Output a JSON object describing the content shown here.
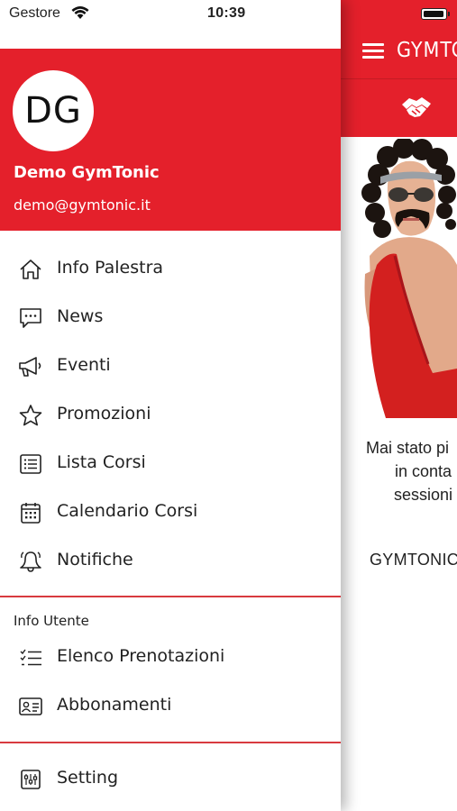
{
  "status_bar": {
    "carrier": "Gestore",
    "time": "10:39"
  },
  "user": {
    "initials": "DG",
    "name": "Demo GymTonic",
    "email": "demo@gymtonic.it"
  },
  "menu": [
    {
      "label": "Info Palestra",
      "icon": "home-icon"
    },
    {
      "label": "News",
      "icon": "chat-bubble-icon"
    },
    {
      "label": "Eventi",
      "icon": "megaphone-icon"
    },
    {
      "label": "Promozioni",
      "icon": "star-icon"
    },
    {
      "label": "Lista Corsi",
      "icon": "list-icon"
    },
    {
      "label": "Calendario Corsi",
      "icon": "calendar-icon"
    },
    {
      "label": "Notifiche",
      "icon": "bell-icon"
    }
  ],
  "user_section": {
    "title": "Info Utente",
    "items": [
      {
        "label": "Elenco Prenotazioni",
        "icon": "checklist-icon"
      },
      {
        "label": "Abbonamenti",
        "icon": "id-card-icon"
      }
    ]
  },
  "settings": {
    "label": "Setting",
    "icon": "settings-sliders-icon"
  },
  "main_screen": {
    "title": "GYMTC",
    "tab_icon": "handshake-icon",
    "promo_lines": [
      "Mai stato pi",
      "in conta",
      "sessioni"
    ],
    "brand": "GYMTONIC"
  },
  "colors": {
    "brand_red": "#e4202b",
    "divider": "#d83a3f",
    "text": "#222222"
  }
}
